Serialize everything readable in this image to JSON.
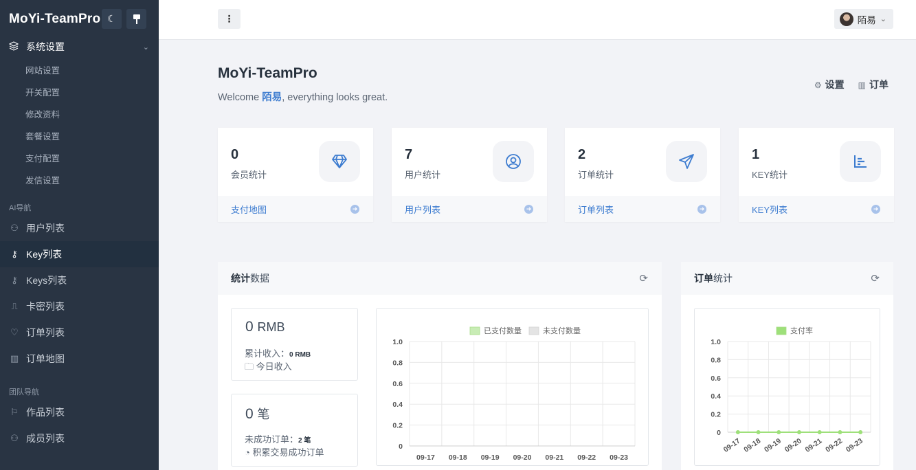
{
  "sidebar": {
    "brand": "MoYi-TeamPro",
    "section": "系统设置",
    "sub_items": [
      "网站设置",
      "开关配置",
      "修改资料",
      "套餐设置",
      "支付配置",
      "发信设置"
    ],
    "group_ai": "AI导航",
    "ai_items": [
      {
        "label": "用户列表",
        "icon": "users-icon"
      },
      {
        "label": "Key列表",
        "icon": "key-icon"
      },
      {
        "label": "Keys列表",
        "icon": "key-icon"
      },
      {
        "label": "卡密列表",
        "icon": "card-icon"
      },
      {
        "label": "订单列表",
        "icon": "heart-icon"
      },
      {
        "label": "订单地图",
        "icon": "map-icon"
      }
    ],
    "group_team": "团队导航",
    "team_items": [
      {
        "label": "作品列表",
        "icon": "signpost-icon"
      },
      {
        "label": "成员列表",
        "icon": "user-icon"
      }
    ]
  },
  "header": {
    "user_name": "陌易"
  },
  "page": {
    "title": "MoYi-TeamPro",
    "welcome_prefix": "Welcome ",
    "welcome_name": "陌易",
    "welcome_suffix": ", everything looks great.",
    "link_settings": "设置",
    "link_orders": "订单"
  },
  "cards": [
    {
      "value": "0",
      "label": "会员统计",
      "link": "支付地图",
      "icon": "diamond-icon"
    },
    {
      "value": "7",
      "label": "用户统计",
      "link": "用户列表",
      "icon": "user-circle-icon"
    },
    {
      "value": "2",
      "label": "订单统计",
      "link": "订单列表",
      "icon": "send-icon"
    },
    {
      "value": "1",
      "label": "KEY统计",
      "link": "KEY列表",
      "icon": "bar-chart-icon"
    }
  ],
  "stats_panel": {
    "title_bold": "统计",
    "title_rest": "数据",
    "income_value": "0",
    "income_unit": "RMB",
    "income_total_label": "累计收入：",
    "income_total_value": "0 RMB",
    "income_today": "今日收入",
    "orders_value": "0",
    "orders_unit": "笔",
    "failed_label": "未成功订单：",
    "failed_value": "2 笔",
    "success_label": "积累交易成功订单"
  },
  "orders_panel": {
    "title_bold": "订单",
    "title_rest": "统计"
  },
  "chart_data": [
    {
      "type": "line",
      "categories": [
        "09-17",
        "09-18",
        "09-19",
        "09-20",
        "09-21",
        "09-22",
        "09-23"
      ],
      "series": [
        {
          "name": "已支付数量",
          "values": [
            0,
            0,
            0,
            0,
            0,
            0,
            0
          ],
          "color": "#c8ecb5"
        },
        {
          "name": "未支付数量",
          "values": [
            0,
            0,
            0,
            0,
            0,
            0,
            0
          ],
          "color": "#e4e4e4"
        }
      ],
      "yticks": [
        "0",
        "0.2",
        "0.4",
        "0.6",
        "0.8",
        "1.0"
      ],
      "ylim": [
        0,
        1
      ],
      "grid": true,
      "legend": "top"
    },
    {
      "type": "line",
      "categories": [
        "09-17",
        "09-18",
        "09-19",
        "09-20",
        "09-21",
        "09-22",
        "09-23"
      ],
      "series": [
        {
          "name": "支付率",
          "values": [
            0,
            0,
            0,
            0,
            0,
            0,
            0
          ],
          "color": "#9ee07a"
        }
      ],
      "yticks": [
        "0",
        "0.2",
        "0.4",
        "0.6",
        "0.8",
        "1.0"
      ],
      "ylim": [
        0,
        1
      ],
      "grid": true,
      "legend": "top"
    }
  ]
}
